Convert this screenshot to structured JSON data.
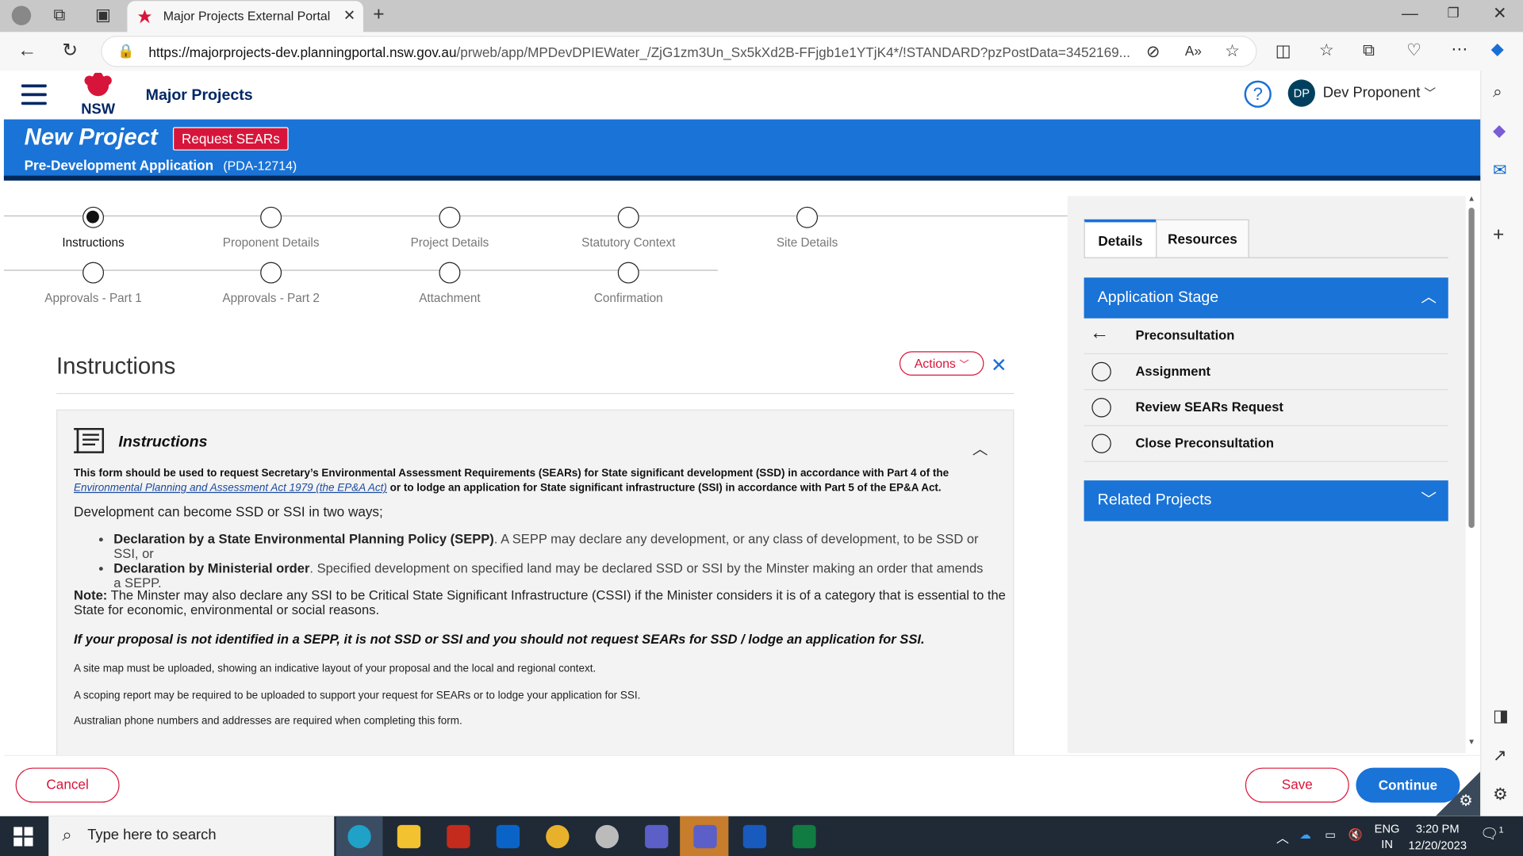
{
  "browser": {
    "tab_title": "Major Projects External Portal",
    "url_host": "https://majorprojects-dev.planningportal.nsw.gov.au",
    "url_path": "/prweb/app/MPDevDPIEWater_/ZjG1zm3Un_Sx5kXd2B-FFjgb1e1YTjK4*/!STANDARD?pzPostData=3452169..."
  },
  "header": {
    "brand": "Major Projects",
    "logo_text": "NSW",
    "help": "?",
    "avatar": "DP",
    "user_name": "Dev Proponent"
  },
  "banner": {
    "title": "New Project",
    "badge": "Request SEARs",
    "subtitle": "Pre-Development Application",
    "id": "(PDA-12714)"
  },
  "steps": [
    {
      "label": "Instructions"
    },
    {
      "label": "Proponent Details"
    },
    {
      "label": "Project Details"
    },
    {
      "label": "Statutory Context"
    },
    {
      "label": "Site Details"
    },
    {
      "label": "Approvals - Part 1"
    },
    {
      "label": "Approvals - Part 2"
    },
    {
      "label": "Attachment"
    },
    {
      "label": "Confirmation"
    }
  ],
  "section": {
    "title": "Instructions",
    "actions": "Actions"
  },
  "card": {
    "title": "Instructions",
    "intro_1": "This form should be used to request Secretary’s Environmental Assessment Requirements (SEARs) for State significant development (SSD) in accordance with Part 4 of the ",
    "intro_link": "Environmental Planning and Assessment Act 1979 (the EP&A Act)",
    "intro_2": " or  to lodge an application for State significant infrastructure (SSI) in accordance with Part 5 of the EP&A Act.",
    "two_ways": "Development can become SSD or SSI in two ways;",
    "bullet_1_bold": "Declaration by a State Environmental Planning Policy (SEPP)",
    "bullet_1_text": ". A SEPP may declare any development, or any class of development, to be SSD or SSI, or",
    "bullet_2_bold": "Declaration by Ministerial order",
    "bullet_2_text": ". Specified development on specified land may be declared SSD or SSI by the Minster making an order that amends a SEPP.",
    "note_label": "Note:",
    "note_text": " The Minster may also declare any SSI to be Critical State Significant Infrastructure (CSSI) if the Minister considers it is of a category that is essential to the State for economic, environmental or social reasons.",
    "warning": "If your proposal is not identified in a SEPP, it is not SSD or SSI and you should not request SEARs for SSD / lodge an application for SSI.",
    "line_1": "A site map must be uploaded, showing an indicative layout of your proposal and the local and regional context.",
    "line_2": "A scoping report may be required to be uploaded to support your request for SEARs or to lodge your application for SSI.",
    "line_3": "Australian phone numbers and addresses are required when completing this form."
  },
  "panel": {
    "tab_details": "Details",
    "tab_resources": "Resources",
    "stage_header": "Application Stage",
    "stages": [
      "Preconsultation",
      "Assignment",
      "Review SEARs Request",
      "Close Preconsultation"
    ],
    "related_header": "Related Projects"
  },
  "footer": {
    "cancel": "Cancel",
    "save": "Save",
    "continue": "Continue"
  },
  "taskbar": {
    "search_placeholder": "Type here to search",
    "lang_1": "ENG",
    "lang_2": "IN",
    "time": "3:20 PM",
    "date": "12/20/2023",
    "notif_count": "1"
  },
  "colors": {
    "brand_navy": "#002664",
    "banner_blue": "#1a73d6",
    "nsw_red": "#d7153a"
  }
}
